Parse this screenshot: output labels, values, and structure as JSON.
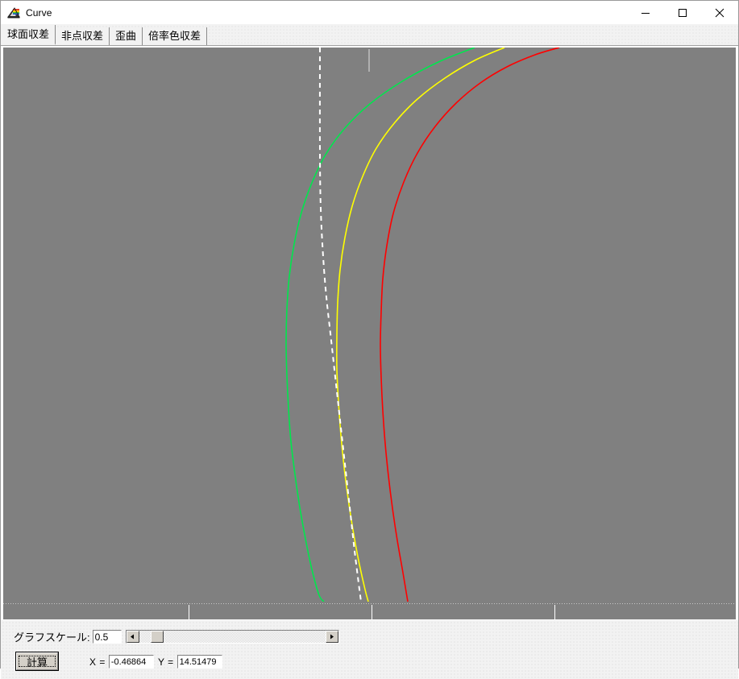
{
  "window": {
    "title": "Curve",
    "icon": "prism-rainbow-icon",
    "controls": {
      "minimize": "minimize-button",
      "maximize": "maximize-button",
      "close": "close-button"
    }
  },
  "tabs": [
    {
      "label": "球面収差",
      "selected": true
    },
    {
      "label": "非点収差",
      "selected": false
    },
    {
      "label": "歪曲",
      "selected": false
    },
    {
      "label": "倍率色収差",
      "selected": false
    }
  ],
  "graph": {
    "background_color": "#808080",
    "axis_line_color": "#ffffff",
    "curves": [
      {
        "name": "green-curve",
        "color": "#00e64d"
      },
      {
        "name": "yellow-curve",
        "color": "#ffff00"
      },
      {
        "name": "red-curve",
        "color": "#ff0000"
      },
      {
        "name": "reference-axis-dashed",
        "color": "#ffffff",
        "style": "dashed"
      }
    ],
    "ruler_ticks": [
      230,
      457,
      684
    ]
  },
  "controls": {
    "scale_label": "グラフスケール:",
    "scale_value": "0.5",
    "scale_placeholder": "0.5",
    "scrollbar_left_arrow": "◄",
    "scrollbar_right_arrow": "►",
    "calculate_label": "計算",
    "x_label": "X =",
    "x_value": "-0.46864",
    "y_label": "Y =",
    "y_value": "14.51479"
  },
  "chart_data": {
    "type": "line",
    "title": "球面収差",
    "xlabel": "",
    "ylabel": "",
    "grid": false,
    "legend": "none",
    "xlim": [
      0,
      911
    ],
    "ylim": [
      688,
      0
    ],
    "series": [
      {
        "name": "green-curve",
        "color": "#00e64d",
        "points": [
          [
            585,
            0
          ],
          [
            540,
            18
          ],
          [
            495,
            42
          ],
          [
            455,
            70
          ],
          [
            424,
            100
          ],
          [
            400,
            133
          ],
          [
            383,
            168
          ],
          [
            370,
            205
          ],
          [
            361,
            244
          ],
          [
            355,
            284
          ],
          [
            352,
            325
          ],
          [
            351,
            366
          ],
          [
            352,
            407
          ],
          [
            354,
            448
          ],
          [
            357,
            489
          ],
          [
            362,
            530
          ],
          [
            368,
            571
          ],
          [
            375,
            610
          ],
          [
            383,
            648
          ],
          [
            392,
            680
          ],
          [
            398,
            688
          ]
        ]
      },
      {
        "name": "yellow-curve",
        "color": "#ffff00",
        "points": [
          [
            622,
            0
          ],
          [
            585,
            16
          ],
          [
            548,
            38
          ],
          [
            514,
            64
          ],
          [
            486,
            93
          ],
          [
            463,
            125
          ],
          [
            446,
            160
          ],
          [
            433,
            197
          ],
          [
            424,
            236
          ],
          [
            418,
            276
          ],
          [
            415,
            317
          ],
          [
            414,
            358
          ],
          [
            414,
            399
          ],
          [
            416,
            440
          ],
          [
            419,
            481
          ],
          [
            423,
            521
          ],
          [
            428,
            560
          ],
          [
            434,
            599
          ],
          [
            441,
            637
          ],
          [
            449,
            673
          ],
          [
            453,
            688
          ]
        ]
      },
      {
        "name": "red-curve",
        "color": "#ff0000",
        "points": [
          [
            690,
            0
          ],
          [
            660,
            9
          ],
          [
            625,
            24
          ],
          [
            592,
            44
          ],
          [
            562,
            69
          ],
          [
            536,
            98
          ],
          [
            514,
            131
          ],
          [
            497,
            167
          ],
          [
            484,
            206
          ],
          [
            476,
            246
          ],
          [
            471,
            287
          ],
          [
            469,
            328
          ],
          [
            468,
            369
          ],
          [
            469,
            410
          ],
          [
            471,
            451
          ],
          [
            474,
            492
          ],
          [
            478,
            532
          ],
          [
            483,
            572
          ],
          [
            489,
            612
          ],
          [
            496,
            652
          ],
          [
            502,
            688
          ]
        ]
      },
      {
        "name": "reference-axis-dashed",
        "color": "#ffffff",
        "style": "dashed",
        "points": [
          [
            393,
            0
          ],
          [
            393,
            130
          ],
          [
            394,
            200
          ],
          [
            397,
            260
          ],
          [
            401,
            310
          ],
          [
            406,
            355
          ],
          [
            411,
            400
          ],
          [
            416,
            445
          ],
          [
            421,
            490
          ],
          [
            426,
            535
          ],
          [
            431,
            580
          ],
          [
            436,
            625
          ],
          [
            441,
            665
          ],
          [
            444,
            688
          ]
        ]
      }
    ]
  }
}
